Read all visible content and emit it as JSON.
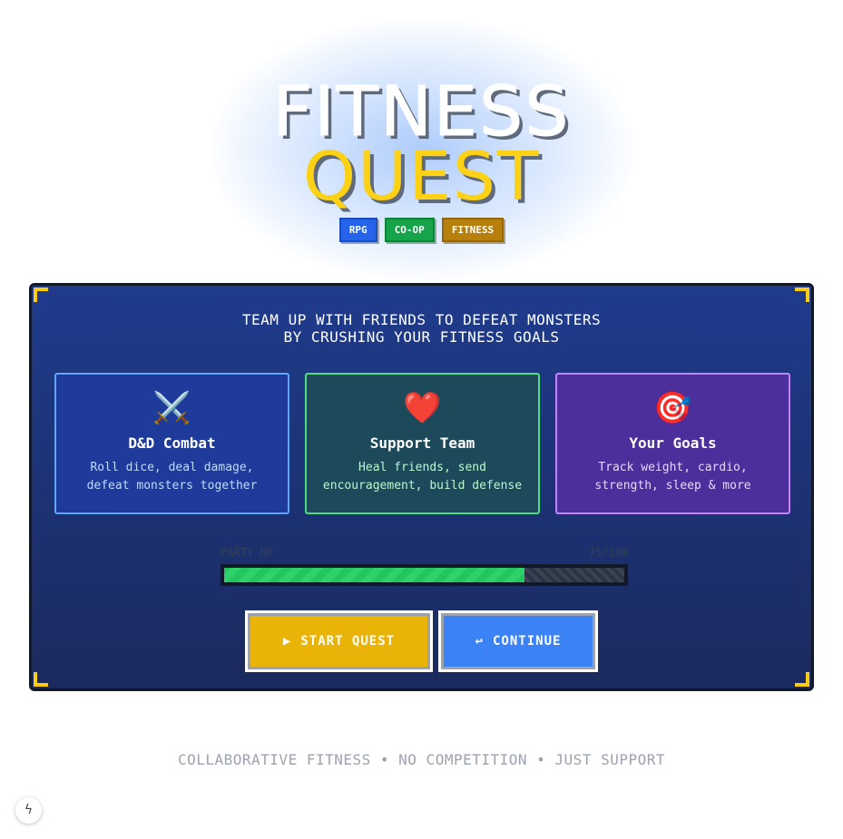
{
  "header": {
    "title_line1": "FITNESS",
    "title_line2": "QUEST",
    "tags": [
      {
        "label": "RPG",
        "color": "#2563eb"
      },
      {
        "label": "CO-OP",
        "color": "#16a34a"
      },
      {
        "label": "FITNESS",
        "color": "#b7800d"
      }
    ]
  },
  "panel": {
    "tagline_line1": "TEAM UP WITH FRIENDS TO DEFEAT MONSTERS",
    "tagline_line2": "BY CRUSHING YOUR FITNESS GOALS",
    "cards": [
      {
        "icon": "crossed-swords-icon",
        "glyph": "⚔️",
        "title": "D&D Combat",
        "desc_line1": "Roll dice, deal damage,",
        "desc_line2": "defeat monsters together"
      },
      {
        "icon": "heart-icon",
        "glyph": "❤️",
        "title": "Support Team",
        "desc_line1": "Heal friends, send",
        "desc_line2": "encouragement, build defense"
      },
      {
        "icon": "target-icon",
        "glyph": "🎯",
        "title": "Your Goals",
        "desc_line1": "Track weight, cardio,",
        "desc_line2": "strength, sleep & more"
      }
    ],
    "hp": {
      "label": "PARTY HP",
      "value_text": "75/100",
      "value": 75,
      "max": 100
    },
    "buttons": {
      "start": "START QUEST",
      "continue": "CONTINUE"
    }
  },
  "footer": {
    "text": "COLLABORATIVE FITNESS • NO COMPETITION • JUST SUPPORT"
  }
}
